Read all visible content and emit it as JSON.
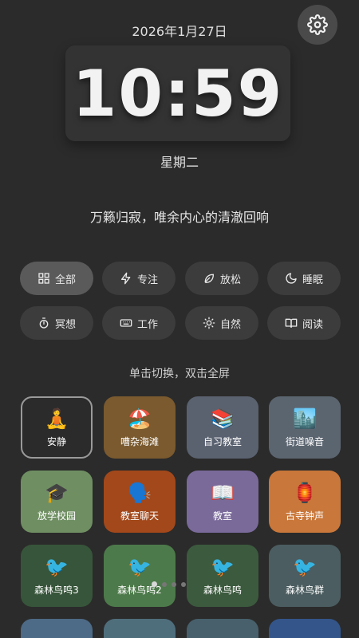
{
  "header": {
    "date": "2026年1月27日",
    "time": "10:59",
    "weekday": "星期二",
    "quote": "万籁归寂，唯余内心的清澈回响",
    "settings_icon": "gear-icon"
  },
  "filters": [
    {
      "label": "全部",
      "icon": "grid-icon",
      "active": true
    },
    {
      "label": "专注",
      "icon": "bolt-icon",
      "active": false
    },
    {
      "label": "放松",
      "icon": "leaf-icon",
      "active": false
    },
    {
      "label": "睡眠",
      "icon": "moon-icon",
      "active": false
    },
    {
      "label": "冥想",
      "icon": "timer-icon",
      "active": false
    },
    {
      "label": "工作",
      "icon": "keyboard-icon",
      "active": false
    },
    {
      "label": "自然",
      "icon": "sun-icon",
      "active": false
    },
    {
      "label": "阅读",
      "icon": "book-icon",
      "active": false
    }
  ],
  "hint": "单击切换，双击全屏",
  "scenes": [
    {
      "label": "安静",
      "emoji": "🧘",
      "color": "#2b2b2b",
      "selected": true
    },
    {
      "label": "嘈杂海滩",
      "emoji": "🏖️",
      "color": "#7a5a2e"
    },
    {
      "label": "自习教室",
      "emoji": "📚",
      "color": "#5a6270"
    },
    {
      "label": "街道噪音",
      "emoji": "🏙️",
      "color": "#5b6570"
    },
    {
      "label": "放学校园",
      "emoji": "🎓",
      "color": "#6f8f62"
    },
    {
      "label": "教室聊天",
      "emoji": "🗣️",
      "color": "#a3481a"
    },
    {
      "label": "教室",
      "emoji": "📖",
      "color": "#7a6a9a"
    },
    {
      "label": "古寺钟声",
      "emoji": "🏮",
      "color": "#c9773a"
    },
    {
      "label": "森林鸟鸣3",
      "emoji": "🐦",
      "color": "#37553a"
    },
    {
      "label": "森林鸟鸣2",
      "emoji": "🐦",
      "color": "#4d7a4a"
    },
    {
      "label": "森林鸟鸣",
      "emoji": "🐦",
      "color": "#3c5a3e"
    },
    {
      "label": "森林鸟群",
      "emoji": "🐦",
      "color": "#4b5d60"
    }
  ],
  "next_row_colors": [
    "#4d6a86",
    "#4f6e7c",
    "#47606c",
    "#33558a"
  ],
  "pager": {
    "count": 4,
    "current": 1
  }
}
